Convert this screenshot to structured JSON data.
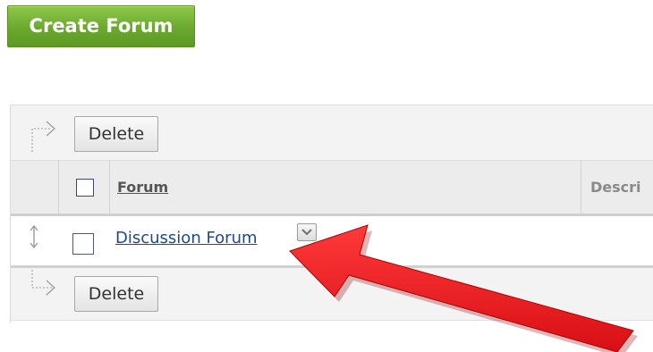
{
  "toolbar": {
    "create_label": "Create Forum"
  },
  "actions": {
    "delete_label": "Delete"
  },
  "table": {
    "columns": [
      "Forum",
      "Descri"
    ],
    "rows": [
      {
        "forum": "Discussion Forum"
      }
    ]
  },
  "colors": {
    "create_button": "#6aa92e",
    "link": "#1b4a8a",
    "annotation_arrow": "#e8161b"
  },
  "icons": {
    "top_bar_arrow": "elbow-arrow-right-icon",
    "bottom_bar_arrow": "elbow-arrow-right-icon",
    "drag": "drag-handle-icon",
    "menu": "chevron-down-icon"
  }
}
